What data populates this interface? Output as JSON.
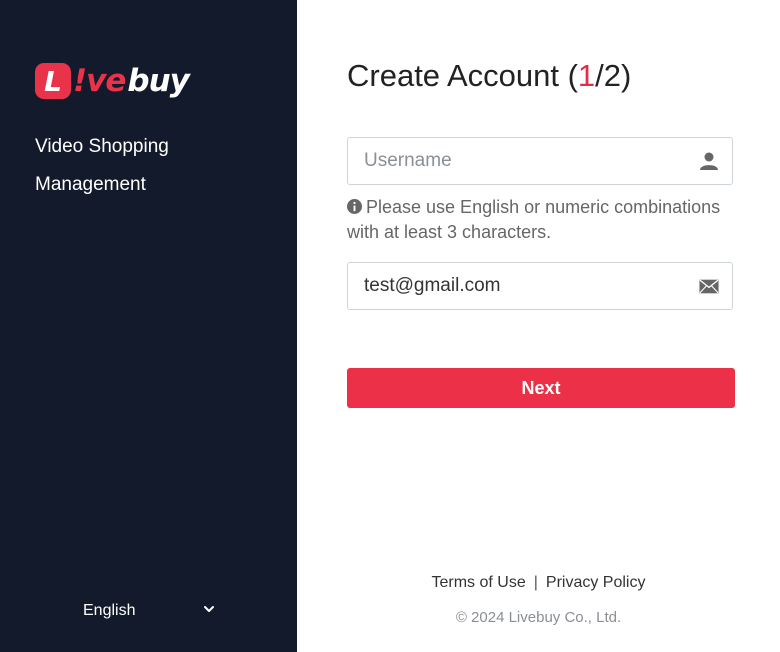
{
  "brand": {
    "logo_badge": "L",
    "logo_ive": "!ve",
    "logo_buy": "buy",
    "tagline": "Video Shopping Management",
    "accent_color": "#e9334b"
  },
  "sidebar": {
    "language_label": "English",
    "language_icon": "chevron-down-icon"
  },
  "form": {
    "title": "Create Account",
    "step_current": "1",
    "step_total": "2",
    "username": {
      "value": "",
      "placeholder": "Username",
      "icon": "user-icon"
    },
    "hint": "Please use English or numeric combinations with at least 3 characters.",
    "hint_icon": "info-icon",
    "email": {
      "value": "test@gmail.com",
      "placeholder": "",
      "icon": "envelope-icon"
    },
    "next_label": "Next"
  },
  "footer": {
    "terms_label": "Terms of Use",
    "privacy_label": "Privacy Policy",
    "copyright": "© 2024 Livebuy Co., Ltd."
  }
}
